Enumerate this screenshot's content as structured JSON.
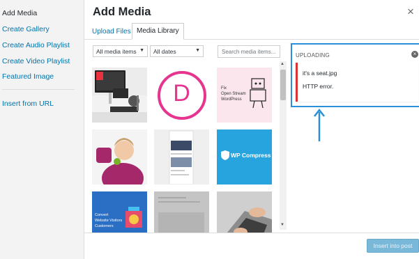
{
  "sidebar": {
    "items": [
      {
        "label": "Add Media",
        "active": true
      },
      {
        "label": "Create Gallery"
      },
      {
        "label": "Create Audio Playlist"
      },
      {
        "label": "Create Video Playlist"
      },
      {
        "label": "Featured Image"
      },
      {
        "label": "Insert from URL"
      }
    ]
  },
  "header": {
    "title": "Add Media",
    "close_icon": "close-icon",
    "close_glyph": "×"
  },
  "tabs": [
    {
      "label": "Upload Files"
    },
    {
      "label": "Media Library",
      "selected": true
    }
  ],
  "filters": {
    "type_selected": "All media items",
    "date_selected": "All dates",
    "search_placeholder": "Search media items..."
  },
  "thumbnails": [
    {
      "name": "desk-computer-photo"
    },
    {
      "name": "divi-logo",
      "letter": "D"
    },
    {
      "name": "open-stream-sketch",
      "text_lines": [
        "Fix",
        "Open Stream",
        "WordPress"
      ]
    },
    {
      "name": "yoast-character"
    },
    {
      "name": "phone-screenshot"
    },
    {
      "name": "wp-compress-logo",
      "text": "WP Compress"
    },
    {
      "name": "convert-visitors-graphic",
      "text_lines": [
        "Convert",
        "Website Visitors",
        "Customers"
      ]
    },
    {
      "name": "grey-screenshot"
    },
    {
      "name": "laptop-hands-photo"
    }
  ],
  "upload_panel": {
    "heading": "UPLOADING",
    "file_name": "it's a seat.jpg",
    "error_message": "HTTP error."
  },
  "footer": {
    "insert_label": "Insert into post"
  },
  "colors": {
    "link": "#0073aa",
    "highlight_border": "#2a8fd6",
    "error": "#dc3232",
    "button": "#7ab8da"
  }
}
